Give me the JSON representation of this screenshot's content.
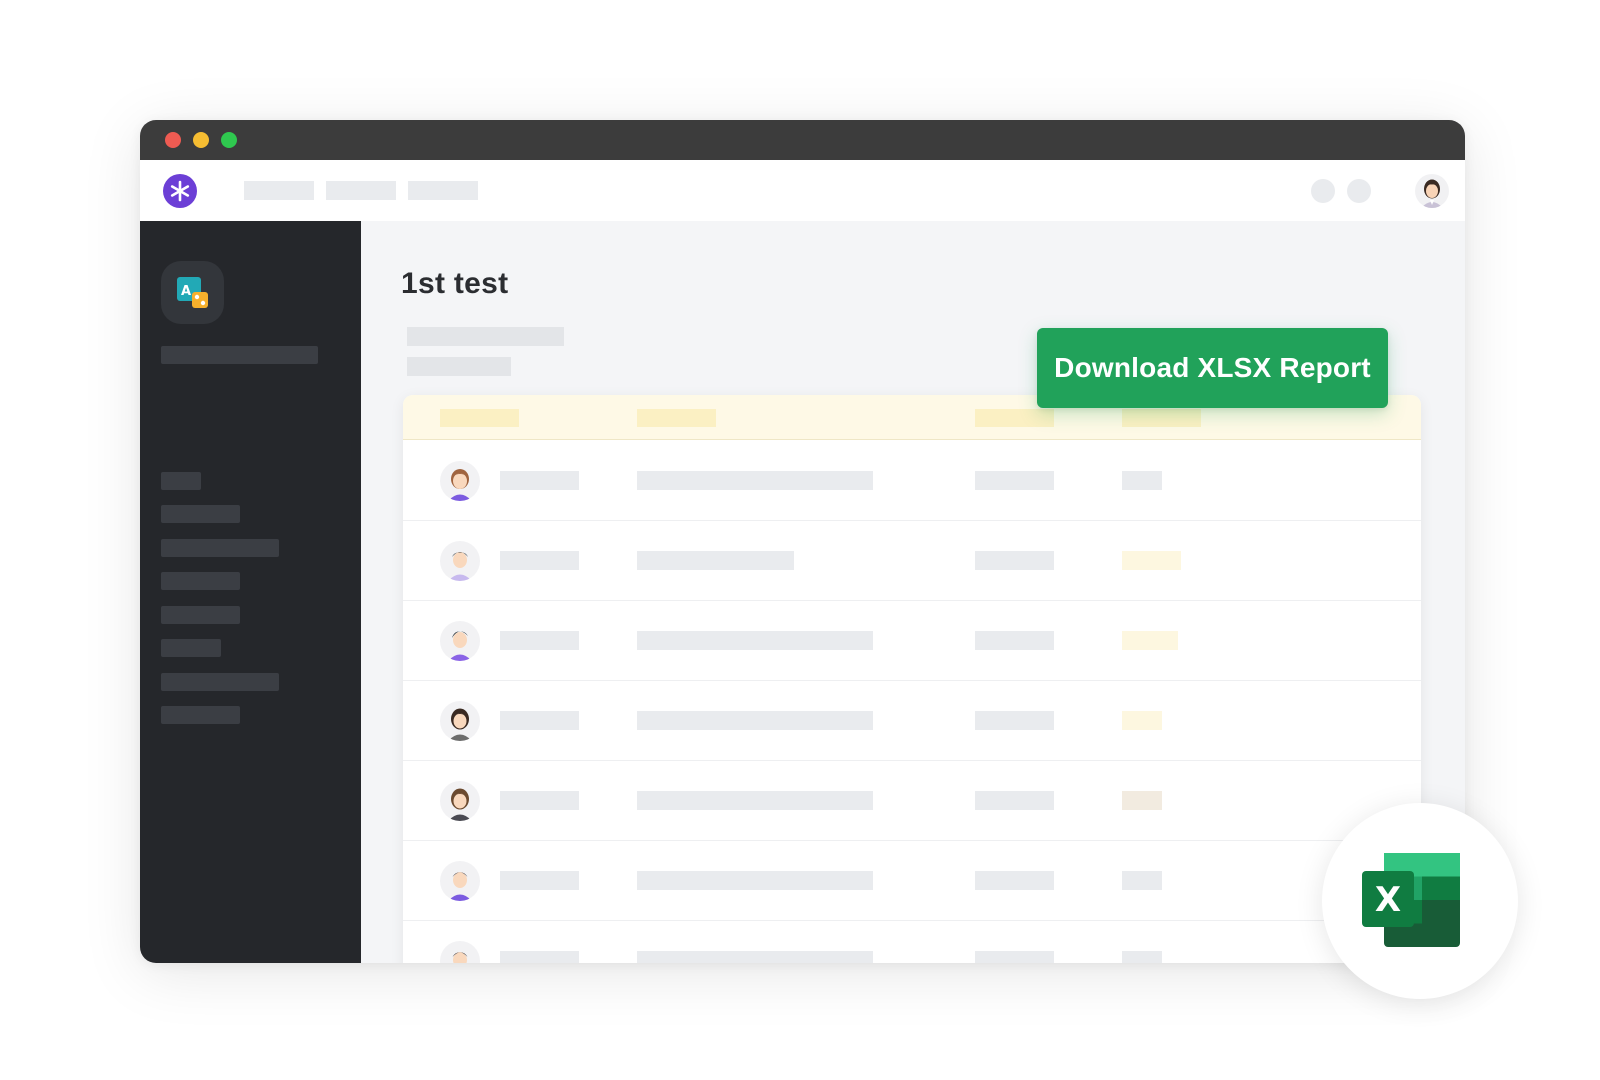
{
  "window": {
    "controls": [
      "close",
      "minimize",
      "maximize"
    ]
  },
  "topnav": {
    "logo_icon": "asterisk-logo-icon",
    "user_avatar_icon": "user-avatar-icon"
  },
  "sidebar": {
    "app_icon": "translate-app-icon"
  },
  "main": {
    "title": "1st test",
    "download_button": "Download XLSX Report"
  },
  "table": {
    "row_count_visible": 7
  },
  "excel_badge": {
    "icon": "excel-icon",
    "letter": "X"
  },
  "colors": {
    "accent_purple": "#6c3fd6",
    "button_green": "#21a25a",
    "sidebar_bg": "#25272b",
    "titlebar_bg": "#3c3c3c",
    "table_header_bg": "#fef9e6"
  }
}
